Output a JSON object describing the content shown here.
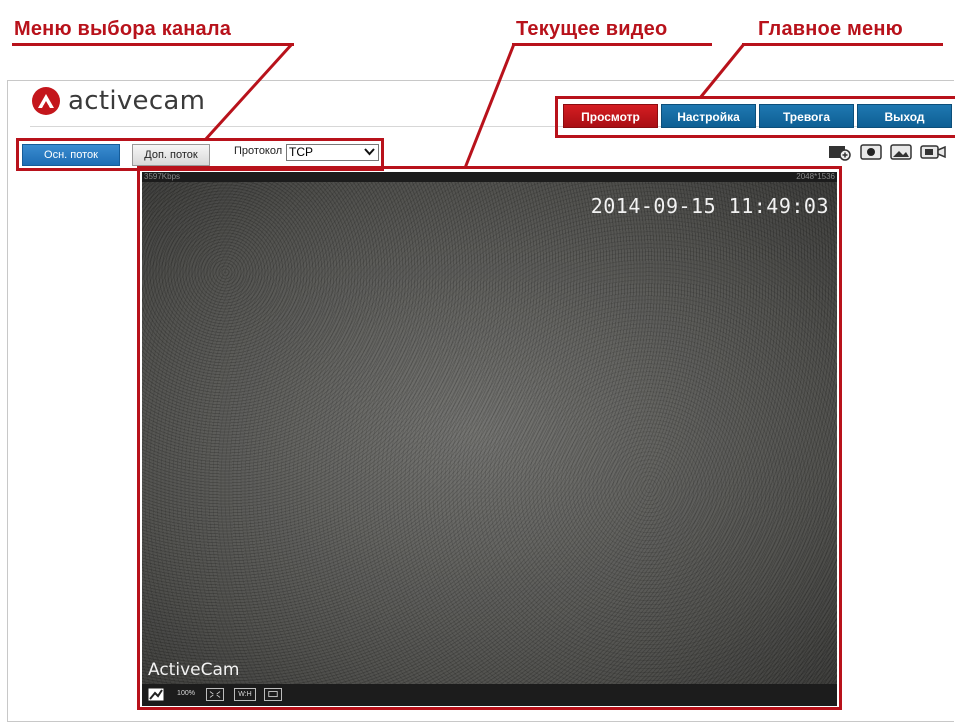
{
  "annotations": {
    "channel_menu": "Меню выбора канала",
    "current_video": "Текущее видео",
    "main_menu": "Главное меню"
  },
  "brand": {
    "name": "activecam",
    "accent_color": "#c4161c"
  },
  "main_menu": {
    "tabs": [
      {
        "label": "Просмотр",
        "active": true
      },
      {
        "label": "Настройка",
        "active": false
      },
      {
        "label": "Тревога",
        "active": false
      },
      {
        "label": "Выход",
        "active": false
      }
    ]
  },
  "stream_selector": {
    "main_stream_label": "Осн. поток",
    "sub_stream_label": "Доп. поток",
    "protocol_label": "Протокол",
    "protocol_value": "TCP"
  },
  "toolbar_icons": [
    "zoom-in-icon",
    "record-icon",
    "snapshot-icon",
    "camera-icon"
  ],
  "video": {
    "bitrate": "3597Kbps",
    "resolution": "2048*1536",
    "timestamp": "2014-09-15 11:49:03",
    "camera_name": "ActiveCam",
    "controls": [
      "fullscreen-icon",
      "100%",
      "fit-icon",
      "W:H",
      "ratio-icon"
    ]
  }
}
